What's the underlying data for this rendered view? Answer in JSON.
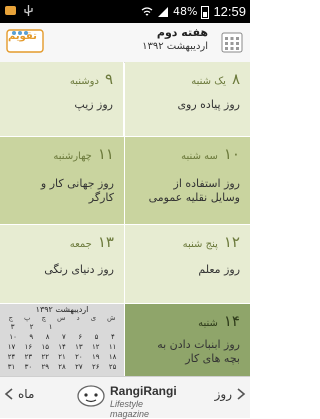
{
  "status": {
    "battery": "48%",
    "time": "12:59"
  },
  "header": {
    "logo_text": "تقویم",
    "week_title": "هفته دوم",
    "month_title": "اردیبهشت ۱۳۹۲"
  },
  "tiles": [
    {
      "number": "۸",
      "day": "یک شنبه",
      "event": "روز پیاده روی"
    },
    {
      "number": "۹",
      "day": "دوشنبه",
      "event": "روز زیپ"
    },
    {
      "number": "۱۰",
      "day": "سه شنبه",
      "event": "روز استفاده از\nوسایل نقلیه عمومی"
    },
    {
      "number": "۱۱",
      "day": "چهارشنبه",
      "event": "روز جهانی کار و\nکارگر"
    },
    {
      "number": "۱۲",
      "day": "پنج شنبه",
      "event": "روز معلم"
    },
    {
      "number": "۱۳",
      "day": "جمعه",
      "event": "روز دنیای رنگی"
    },
    {
      "number": "۱۴",
      "day": "شنبه",
      "event": "روز ابنبات دادن به\nبچه های کار"
    }
  ],
  "mini_calendar": {
    "title": "اردیبهشت ۱۳۹۲",
    "weekdays": [
      "ش",
      "ی",
      "د",
      "س",
      "چ",
      "پ",
      "ج"
    ],
    "rows": [
      [
        "",
        "",
        "",
        "",
        "۱",
        "۲",
        "۳"
      ],
      [
        "۴",
        "۵",
        "۶",
        "۷",
        "۸",
        "۹",
        "۱۰"
      ],
      [
        "۱۱",
        "۱۲",
        "۱۳",
        "۱۴",
        "۱۵",
        "۱۶",
        "۱۷"
      ],
      [
        "۱۸",
        "۱۹",
        "۲۰",
        "۲۱",
        "۲۲",
        "۲۳",
        "۲۴"
      ],
      [
        "۲۵",
        "۲۶",
        "۲۷",
        "۲۸",
        "۲۹",
        "۳۰",
        "۳۱"
      ]
    ]
  },
  "footer": {
    "prev_label": "ماه",
    "next_label": "روز",
    "brand_name": "RangiRangi",
    "brand_sub": "Lifestyle magazine"
  },
  "colors": {
    "tile_light": "#e7ecd2",
    "tile_mid": "#c9d49f",
    "tile_dark": "#8fa56a",
    "accent": "#6c7a3c"
  }
}
